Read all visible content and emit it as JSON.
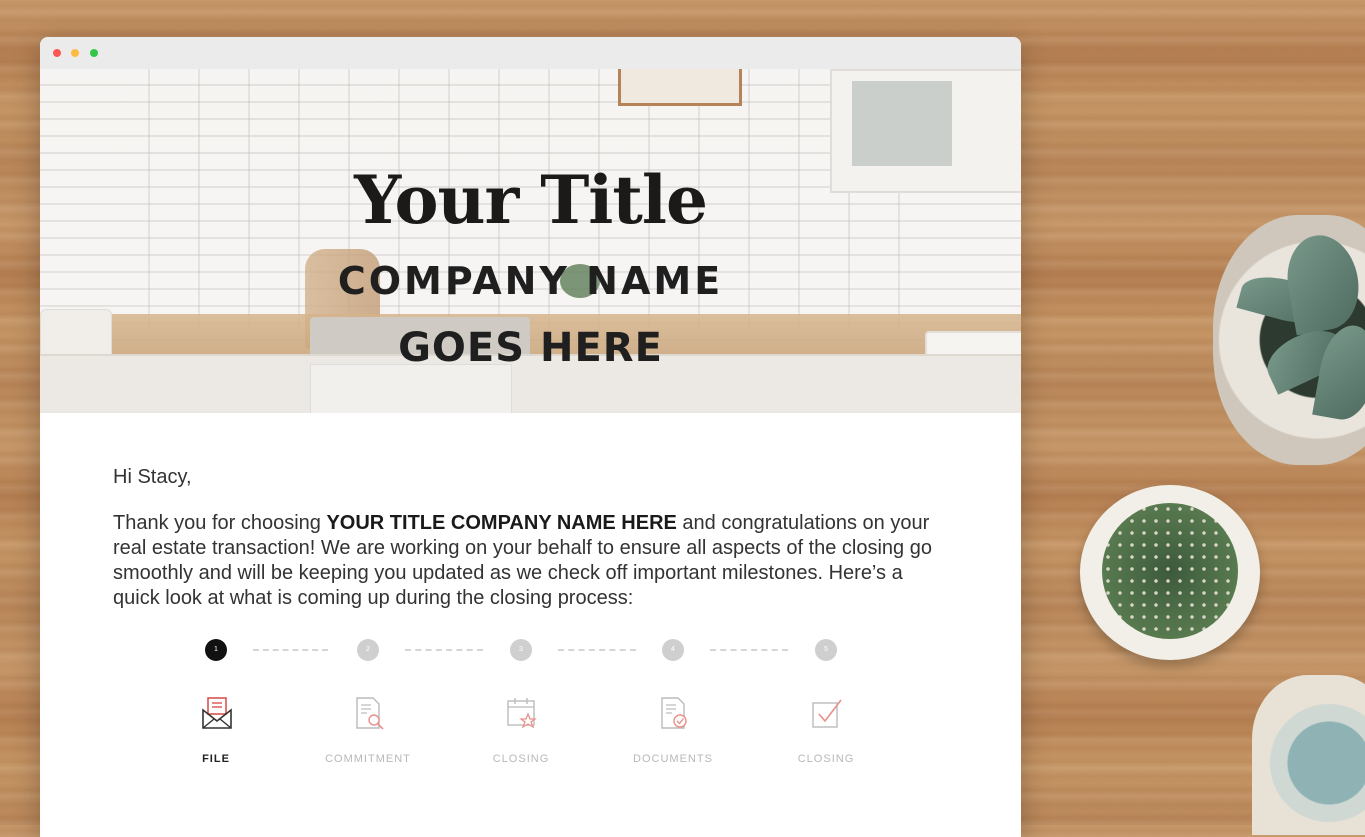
{
  "hero": {
    "title": "Your Title",
    "company_line": "COMPANY NAME",
    "goes_line": "GOES HERE"
  },
  "email": {
    "greeting": "Hi Stacy,",
    "intro_before": "Thank you for choosing ",
    "intro_bold": "YOUR TITLE COMPANY NAME HERE",
    "intro_after": " and congratulations on your real estate transaction! We are working on your behalf to ensure all aspects of the closing go smoothly and will be keeping you updated as we check off important milestones. Here’s a quick look at what is coming up during the closing process:"
  },
  "progress": {
    "steps": [
      {
        "number": "1",
        "label": "FILE",
        "icon": "envelope-icon",
        "active": true
      },
      {
        "number": "2",
        "label": "COMMITMENT",
        "icon": "document-search-icon",
        "active": false
      },
      {
        "number": "3",
        "label": "CLOSING",
        "icon": "calendar-star-icon",
        "active": false
      },
      {
        "number": "4",
        "label": "DOCUMENTS",
        "icon": "document-check-icon",
        "active": false
      },
      {
        "number": "5",
        "label": "CLOSING",
        "icon": "checkbox-icon",
        "active": false
      }
    ]
  },
  "colors": {
    "active_step": "#111111",
    "inactive_step": "#cfcfcf",
    "icon_accent": "#e8908a",
    "window_close": "#fd5753",
    "window_minimize": "#fdbc40",
    "window_zoom": "#33c748"
  }
}
